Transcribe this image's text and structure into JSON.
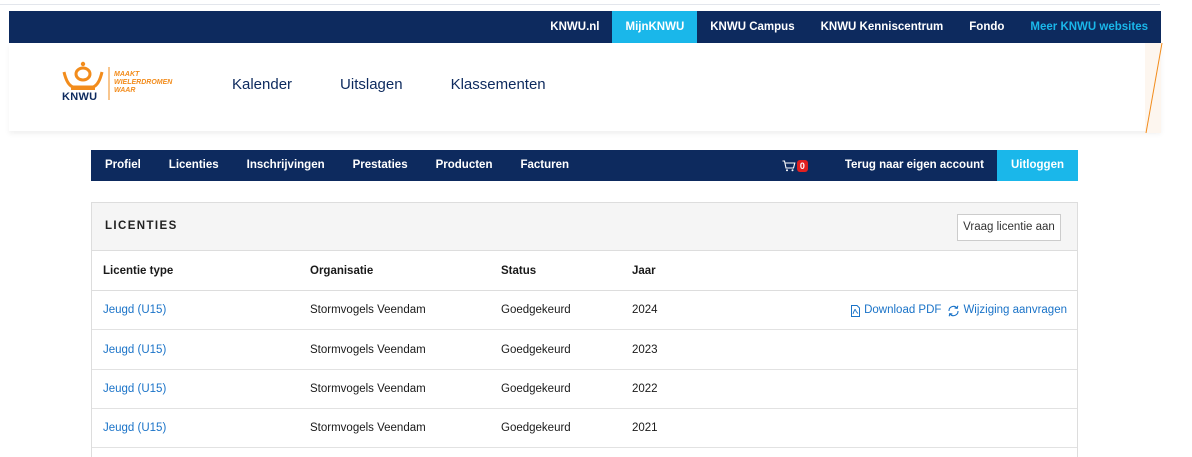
{
  "topbar": {
    "links": [
      "KNWU.nl",
      "MijnKNWU",
      "KNWU Campus",
      "KNWU Kenniscentrum",
      "Fondo",
      "Meer KNWU websites"
    ]
  },
  "logo": {
    "brand": "KNWU",
    "slogan_1": "MAAKT",
    "slogan_2": "WIELERDROMEN",
    "slogan_3": "WAAR"
  },
  "mainnav": [
    "Kalender",
    "Uitslagen",
    "Klassementen"
  ],
  "subnav": {
    "items": [
      "Profiel",
      "Licenties",
      "Inschrijvingen",
      "Prestaties",
      "Producten",
      "Facturen"
    ],
    "cart_count": "0",
    "terug": "Terug naar eigen account",
    "uitloggen": "Uitloggen"
  },
  "panel": {
    "title": "LICENTIES",
    "request_button": "Vraag licentie aan",
    "columns": [
      "Licentie type",
      "Organisatie",
      "Status",
      "Jaar"
    ],
    "rows": [
      {
        "type": "Jeugd (U15)",
        "org": "Stormvogels Veendam",
        "status": "Goedgekeurd",
        "year": "2024"
      },
      {
        "type": "Jeugd (U15)",
        "org": "Stormvogels Veendam",
        "status": "Goedgekeurd",
        "year": "2023"
      },
      {
        "type": "Jeugd (U15)",
        "org": "Stormvogels Veendam",
        "status": "Goedgekeurd",
        "year": "2022"
      },
      {
        "type": "Jeugd (U15)",
        "org": "Stormvogels Veendam",
        "status": "Goedgekeurd",
        "year": "2021"
      }
    ],
    "actions": {
      "download": "Download PDF",
      "wijziging": "Wijziging aanvragen"
    }
  },
  "colors": {
    "navy": "#0d2a5e",
    "cyan": "#1ab7ea",
    "orange": "#f28c1c",
    "link": "#1a73c8",
    "badge": "#e02020"
  },
  "icons": [
    "crown-logo-icon",
    "cart-icon",
    "pdf-icon",
    "refresh-icon"
  ]
}
